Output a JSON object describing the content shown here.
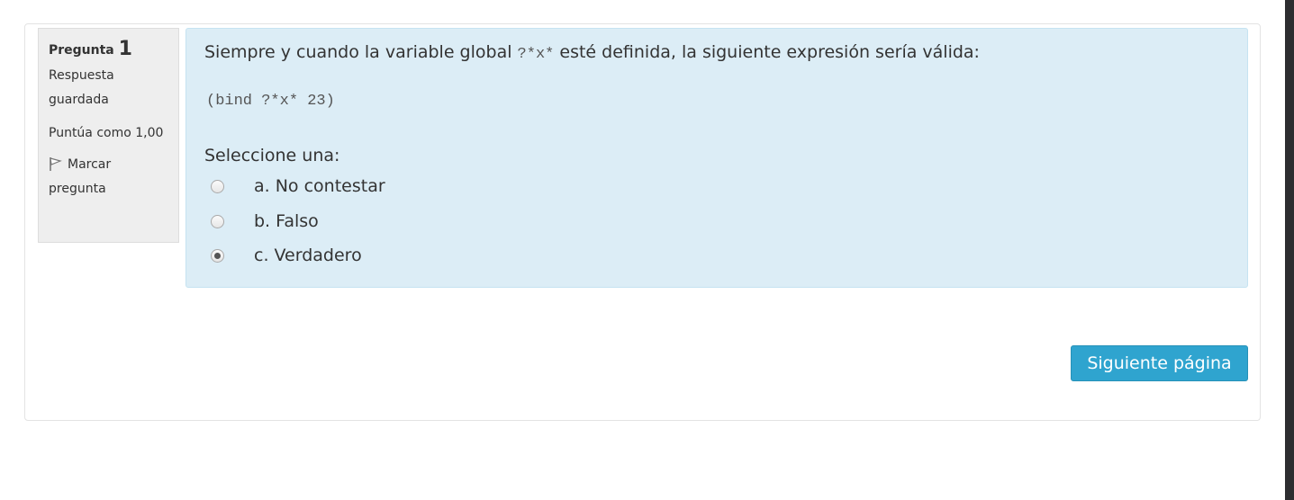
{
  "question_info": {
    "label": "Pregunta",
    "number": "1",
    "state": "Respuesta guardada",
    "grade": "Puntúa como 1,00",
    "flag_label": "Marcar pregunta"
  },
  "question": {
    "text_before": "Siempre y cuando la variable global ",
    "text_code": "?*x*",
    "text_after": " esté definida, la siguiente expresión sería válida:",
    "code": "(bind ?*x* 23)",
    "prompt": "Seleccione una:",
    "answers": [
      {
        "label": "a. No contestar",
        "selected": false
      },
      {
        "label": "b. Falso",
        "selected": false
      },
      {
        "label": "c. Verdadero",
        "selected": true
      }
    ]
  },
  "navigation": {
    "next_label": "Siguiente página"
  },
  "colors": {
    "content_background": "#dcedf6",
    "info_background": "#eeeeee",
    "button_background": "#2fa4cf"
  },
  "icons": {
    "flag": "flag-icon"
  }
}
